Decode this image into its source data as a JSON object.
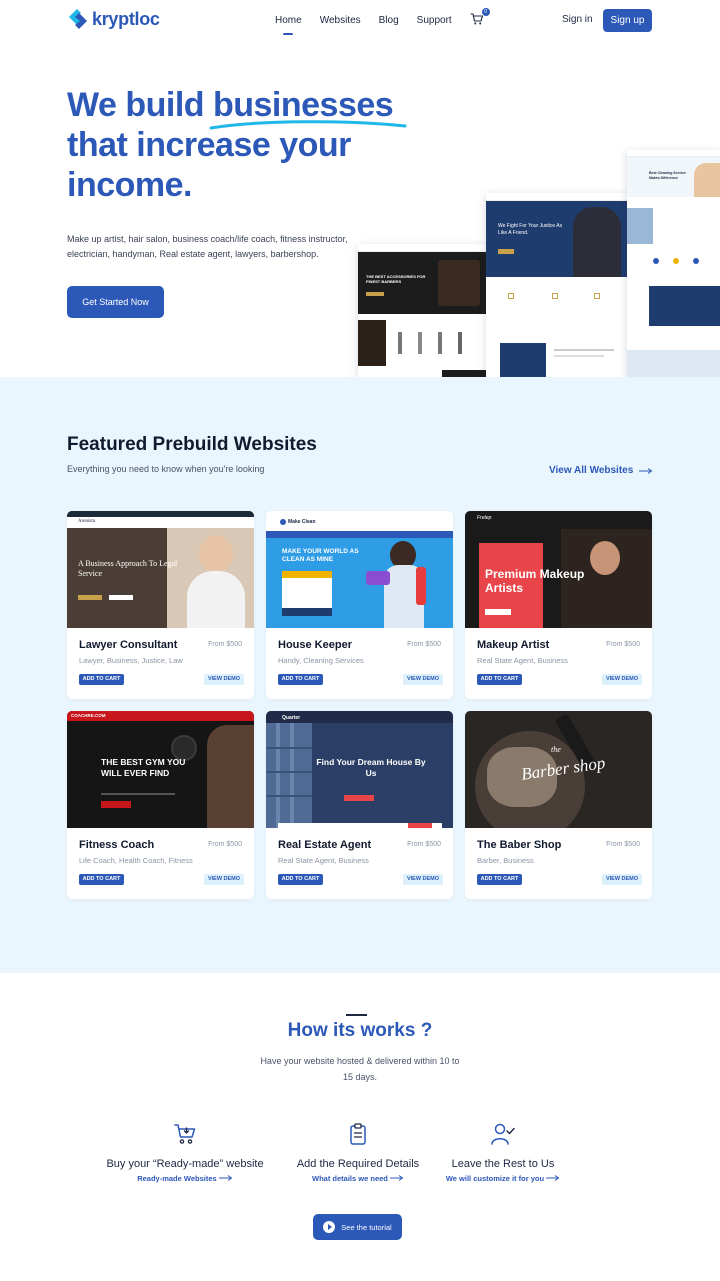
{
  "nav": {
    "logo_text": "kryptloc",
    "links": [
      {
        "label": "Home",
        "active": true
      },
      {
        "label": "Websites",
        "active": false
      },
      {
        "label": "Blog",
        "active": false
      },
      {
        "label": "Support",
        "active": false
      }
    ],
    "cart_count": "0",
    "signin_label": "Sign in",
    "signup_label": "Sign up"
  },
  "hero": {
    "title_line1_a": "We build ",
    "title_line1_b": "businesses",
    "title_line2": "that increase your",
    "title_line3": "income.",
    "subtitle": "Make up artist, hair salon, business coach/life coach, fitness instructor, electrician, handyman, Real estate agent, lawyers, barbershop.",
    "cta_label": "Get Started Now",
    "mockups": {
      "barber_heading": "THE BEST ACCESSORIES FOR FINEST BARBERS",
      "law_heading": "We Fight For Your Justice As Like A Friend.",
      "cleaning_heading": "Best Cleaning Service Makes Difference"
    }
  },
  "featured": {
    "title": "Featured Prebuild Websites",
    "subtitle": "Everything you need to know when you're looking",
    "view_all_label": "View All Websites",
    "add_to_cart_label": "ADD TO CART",
    "view_demo_label": "VIEW DEMO",
    "cards": [
      {
        "name": "Lawyer Consultant",
        "price": "From $500",
        "categories": "Lawyer, Business, Justice, Law",
        "thumb_heading": "A Business Approach To Legal Service",
        "thumb_brand": "Arenista"
      },
      {
        "name": "House Keeper",
        "price": "From $500",
        "categories": "Handy, Cleaning Services",
        "thumb_heading": "MAKE YOUR WORLD AS CLEAN AS MINE",
        "thumb_brand": "Make Clean"
      },
      {
        "name": "Makeup Artist",
        "price": "From $500",
        "categories": "Real State Agent, Business",
        "thumb_heading": "Premium Makeup Artists",
        "thumb_brand": "Fretep"
      },
      {
        "name": "Fitness Coach",
        "price": "From $500",
        "categories": "Life Coach, Health Coach, Fitness",
        "thumb_heading": "THE BEST GYM YOU WILL EVER FIND",
        "thumb_brand": "COACHRE.COM"
      },
      {
        "name": "Real Estate Agent",
        "price": "From $500",
        "categories": "Real State Agent, Business",
        "thumb_heading": "Find Your Dream House By Us",
        "thumb_brand": "Quarter"
      },
      {
        "name": "The Baber Shop",
        "price": "From $500",
        "categories": "Barber, Business",
        "thumb_heading": "Barber shop",
        "thumb_brand": "the"
      }
    ]
  },
  "how": {
    "title": "How its works ?",
    "subtitle": "Have your website  hosted & delivered within 10 to 15 days.",
    "steps": [
      {
        "title": "Buy your “Ready-made” website",
        "link": "Ready-made Websites",
        "icon": "cart-icon"
      },
      {
        "title": "Add the Required Details",
        "link": "What details we need",
        "icon": "clipboard-icon"
      },
      {
        "title": "Leave the Rest to Us",
        "link": "We will customize it for you",
        "icon": "user-check-icon"
      }
    ],
    "tutorial_label": "See the tutorial"
  },
  "colors": {
    "brand": "#2c58b8",
    "accent_cyan": "#1fb6e8",
    "section_bg": "#eaf6fd"
  }
}
